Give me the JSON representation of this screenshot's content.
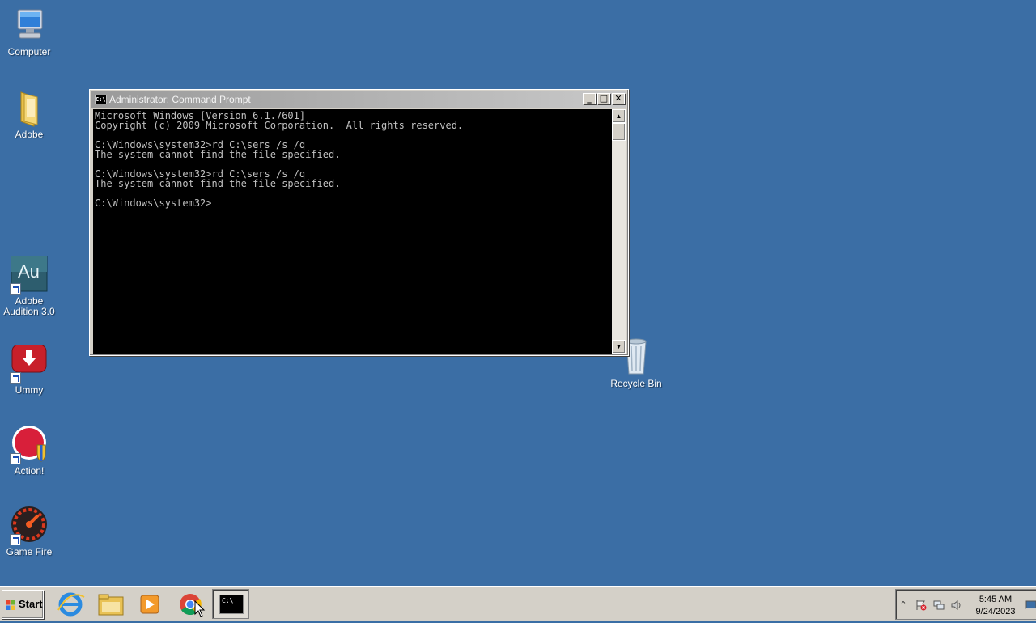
{
  "desktop": {
    "icons": [
      {
        "label": "Computer"
      },
      {
        "label": "Adobe"
      },
      {
        "label_line1": "Adobe",
        "label_line2": "Audition 3.0",
        "glyph_text": "Au"
      },
      {
        "label": "Ummy"
      },
      {
        "label": "Action!"
      },
      {
        "label": "Game Fire"
      },
      {
        "label": "Recycle Bin"
      }
    ]
  },
  "window": {
    "title": "Administrator: Command Prompt",
    "icon_text": "C:\\",
    "buttons": {
      "minimize": "_",
      "maximize": "□",
      "close": "✕"
    },
    "console_lines": [
      "Microsoft Windows [Version 6.1.7601]",
      "Copyright (c) 2009 Microsoft Corporation.  All rights reserved.",
      "",
      "C:\\Windows\\system32>rd C:\\sers /s /q",
      "The system cannot find the file specified.",
      "",
      "C:\\Windows\\system32>rd C:\\sers /s /q",
      "The system cannot find the file specified.",
      "",
      "C:\\Windows\\system32>"
    ]
  },
  "taskbar": {
    "start_label": "Start",
    "pinned": [
      {
        "name": "internet-explorer-icon"
      },
      {
        "name": "windows-explorer-icon"
      },
      {
        "name": "media-player-icon"
      },
      {
        "name": "chrome-icon"
      },
      {
        "name": "command-prompt-icon",
        "text": "C:\\_"
      }
    ],
    "tray": {
      "show_hidden": "⌃",
      "time": "5:45 AM",
      "date": "9/24/2023"
    }
  },
  "colors": {
    "desktop": "#3b6ea5",
    "taskbar": "#d4d0c8",
    "console_bg": "#000000",
    "console_fg": "#c0c0c0"
  }
}
